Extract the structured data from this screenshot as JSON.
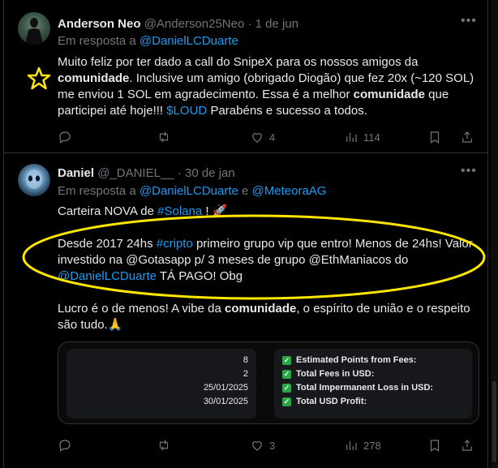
{
  "tweets": [
    {
      "author_name": "Anderson Neo",
      "author_handle": "@Anderson25Neo",
      "date": "1 de jun",
      "reply_prefix": "Em resposta a",
      "reply_to": "@DanielLCDuarte",
      "body": {
        "p1": "Muito feliz por ter dado a call do SnipeX para os nossos amigos da",
        "p1_bold": "comunidade",
        "p2": ". Inclusive um amigo (obrigado Diogão) que fez 20x (~120 SOL) me enviou 1 SOL em agradecimento. Essa é a melhor",
        "p2_bold": "comunidade",
        "p3": "que participei até hoje!!!",
        "cashtag": "$LOUD",
        "p4": "Parabéns e sucesso a todos."
      },
      "actions": {
        "reply": "",
        "retweet": "",
        "like": "4",
        "views": "114"
      }
    },
    {
      "author_name": "Daniel",
      "author_handle": "@_DANIEL__",
      "date": "30 de jan",
      "reply_prefix": "Em resposta a",
      "reply_to": "@DanielLCDuarte",
      "reply_and": "e",
      "reply_to2": "@MeteoraAG",
      "body": {
        "line1": "Carteira NOVA de",
        "hashtag1": "#Solana",
        "line1_end": "!",
        "para2_a": "Desde 2017 24hs",
        "hashtag2": "#cripto",
        "para2_b": "primeiro grupo vip que entro! Menos de 24hs! Valor investido na @Gotasapp p/ 3 meses de grupo @EthManiacos do",
        "mention": "@DanielLCDuarte",
        "para2_c": "TÁ PAGO! Obg",
        "para3_a": "Lucro é o de menos! A vibe da",
        "para3_bold": "comunidade",
        "para3_b": ", o espírito de união e o respeito são tudo.",
        "emoji": "🙏"
      },
      "card": {
        "values": [
          "8",
          "2",
          "25/01/2025",
          "30/01/2025"
        ],
        "labels": [
          "Estimated Points from Fees:",
          "Total Fees in USD:",
          "Total Impermanent Loss in USD:",
          "Total USD Profit:"
        ]
      },
      "actions": {
        "reply": "",
        "retweet": "",
        "like": "3",
        "views": "278"
      }
    }
  ],
  "colors": {
    "link": "#1d9bf0",
    "muted": "#71767b",
    "text": "#e7e9ea",
    "annotation": "#ffe600",
    "check": "#2aa647"
  }
}
